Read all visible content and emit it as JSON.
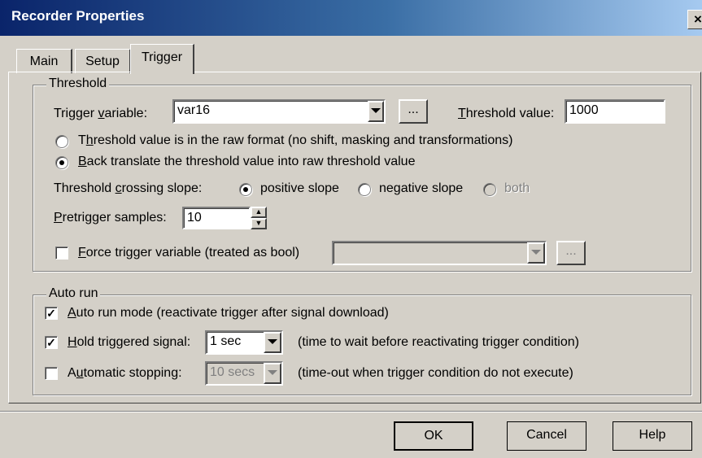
{
  "window": {
    "title": "Recorder Properties",
    "close_glyph": "×"
  },
  "tabs": [
    {
      "label": "Main"
    },
    {
      "label": "Setup"
    },
    {
      "label": "Trigger"
    }
  ],
  "threshold_group": {
    "label": "Threshold",
    "trigger_variable_label_pre": "Trigger ",
    "trigger_variable_label_u": "v",
    "trigger_variable_label_post": "ariable:",
    "trigger_variable_value": "var16",
    "browse_label": "...",
    "threshold_value_label_u": "T",
    "threshold_value_label_post": "hreshold value:",
    "threshold_value": "1000",
    "raw_format_pre": "T",
    "raw_format_u": "h",
    "raw_format_post": "reshold value is in the raw format (no shift, masking and transformations)",
    "back_translate_pre": "",
    "back_translate_u": "B",
    "back_translate_post": "ack translate the threshold value into raw threshold value",
    "slope_label_pre": "Threshold ",
    "slope_label_u": "c",
    "slope_label_post": "rossing slope:",
    "slope_positive": "positive slope",
    "slope_negative": "negative slope",
    "slope_both": "both",
    "pretrigger_label_u": "P",
    "pretrigger_label_post": "retrigger samples:",
    "pretrigger_value": "10",
    "force_label_u": "F",
    "force_label_post": "orce trigger variable (treated as bool)",
    "force_browse_label": "..."
  },
  "autorun_group": {
    "label": "Auto run",
    "auto_run_u": "A",
    "auto_run_post": "uto run mode (reactivate trigger after signal download)",
    "hold_u": "H",
    "hold_post": "old triggered signal:",
    "hold_value": "1 sec",
    "hold_desc": "(time to wait before reactivating trigger condition)",
    "stop_pre": "A",
    "stop_u": "u",
    "stop_post": "tomatic stopping:",
    "stop_value": "10 secs",
    "stop_desc": "(time-out when trigger condition do not execute)"
  },
  "buttons": {
    "ok": "OK",
    "cancel": "Cancel",
    "help": "Help"
  }
}
